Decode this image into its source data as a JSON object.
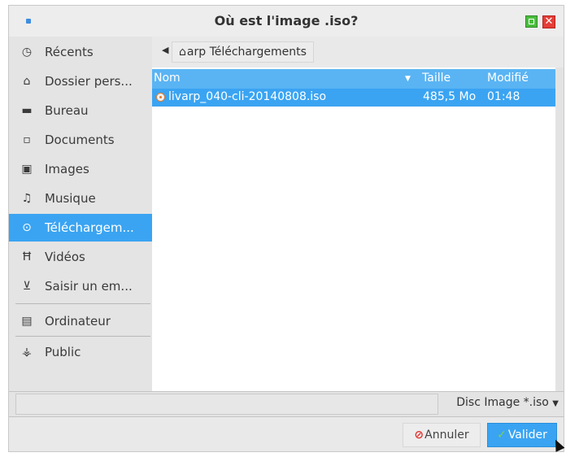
{
  "window": {
    "title": "Où est l'image .iso?"
  },
  "sidebar": {
    "items": [
      {
        "label": "Récents",
        "icon": "clock-icon"
      },
      {
        "label": "Dossier pers...",
        "icon": "home-icon"
      },
      {
        "label": "Bureau",
        "icon": "folder-icon"
      },
      {
        "label": "Documents",
        "icon": "document-icon"
      },
      {
        "label": "Images",
        "icon": "image-icon"
      },
      {
        "label": "Musique",
        "icon": "music-icon"
      },
      {
        "label": "Téléchargem...",
        "icon": "download-icon",
        "selected": true
      },
      {
        "label": "Vidéos",
        "icon": "video-icon"
      },
      {
        "label": "Saisir un em...",
        "icon": "network-icon"
      },
      {
        "label": "Ordinateur",
        "icon": "computer-icon"
      },
      {
        "label": "Public",
        "icon": "public-icon"
      }
    ]
  },
  "pathbar": {
    "crumb": "arp Téléchargements"
  },
  "columns": {
    "name": "Nom",
    "size": "Taille",
    "modified": "Modifié"
  },
  "files": [
    {
      "name": "livarp_040-cli-20140808.iso",
      "size": "485,5 Mo",
      "modified": "01:48",
      "selected": true
    }
  ],
  "filter": {
    "selected": "Disc Image *.iso"
  },
  "buttons": {
    "cancel": "Annuler",
    "ok": "Valider"
  },
  "colors": {
    "accent": "#3aa4f2",
    "cancel_icon": "#e0352f",
    "close": "#e53c36",
    "maximize": "#4bbd3e"
  }
}
